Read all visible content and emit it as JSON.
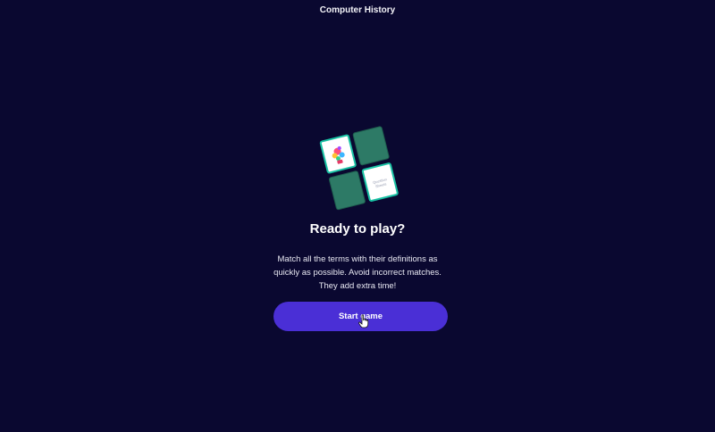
{
  "header": {
    "title": "Computer History"
  },
  "illustration": {
    "card_face_text": "Question\nSheets",
    "colors": {
      "card_back": "#2d7a66",
      "card_border": "#19c2a4"
    },
    "icons": [
      "sticker-art-icon"
    ]
  },
  "main": {
    "heading": "Ready to play?",
    "description": "Match all the terms with their definitions as quickly as possible. Avoid incorrect matches. They add extra time!",
    "start_button_label": "Start game"
  },
  "colors": {
    "background": "#0a0830",
    "accent": "#4a2fd6"
  },
  "cursor": {
    "icon": "hand-pointer-icon"
  }
}
